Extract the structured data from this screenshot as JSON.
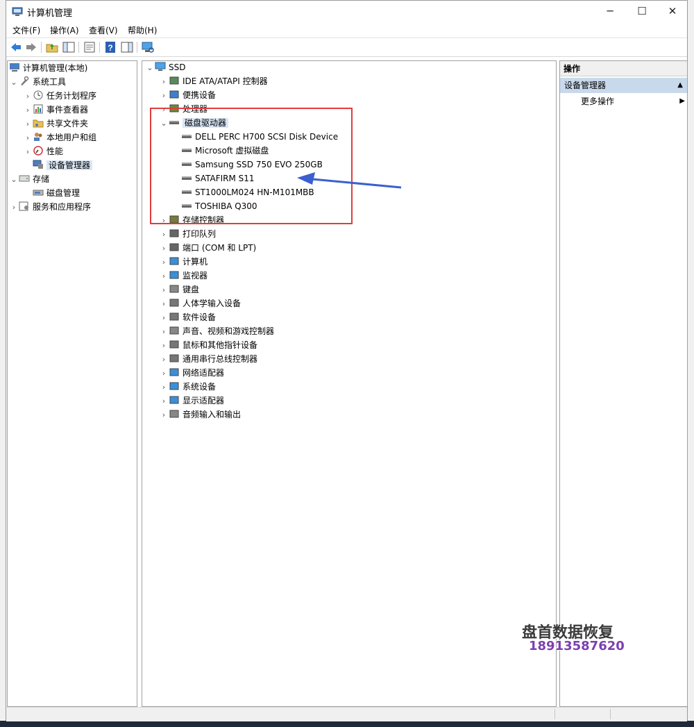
{
  "window": {
    "title": "计算机管理",
    "minimize": "─",
    "maximize": "☐",
    "close": "✕"
  },
  "menu": [
    "文件(F)",
    "操作(A)",
    "查看(V)",
    "帮助(H)"
  ],
  "left_tree": {
    "root": "计算机管理(本地)",
    "system_tools": "系统工具",
    "task_scheduler": "任务计划程序",
    "event_viewer": "事件查看器",
    "shared_folders": "共享文件夹",
    "local_users": "本地用户和组",
    "performance": "性能",
    "device_manager": "设备管理器",
    "storage": "存储",
    "disk_management": "磁盘管理",
    "services": "服务和应用程序"
  },
  "device_tree": {
    "root": "SSD",
    "categories": [
      "IDE ATA/ATAPI 控制器",
      "便携设备",
      "处理器",
      "磁盘驱动器",
      "存储控制器",
      "打印队列",
      "端口 (COM 和 LPT)",
      "计算机",
      "监视器",
      "键盘",
      "人体学输入设备",
      "软件设备",
      "声音、视频和游戏控制器",
      "鼠标和其他指针设备",
      "通用串行总线控制器",
      "网络适配器",
      "系统设备",
      "显示适配器",
      "音频输入和输出"
    ],
    "disks": [
      "DELL PERC H700 SCSI Disk Device",
      "Microsoft 虚拟磁盘",
      "Samsung SSD 750 EVO 250GB",
      "SATAFIRM   S11",
      "ST1000LM024 HN-M101MBB",
      "TOSHIBA Q300"
    ]
  },
  "actions": {
    "header": "操作",
    "section": "设备管理器",
    "more": "更多操作"
  },
  "watermark": {
    "name": "盘首数据恢复",
    "phone": "18913587620"
  },
  "colors": {
    "annotation_box": "#e03c3c",
    "arrow": "#3b5fd0",
    "selection": "#d9e6f5"
  }
}
